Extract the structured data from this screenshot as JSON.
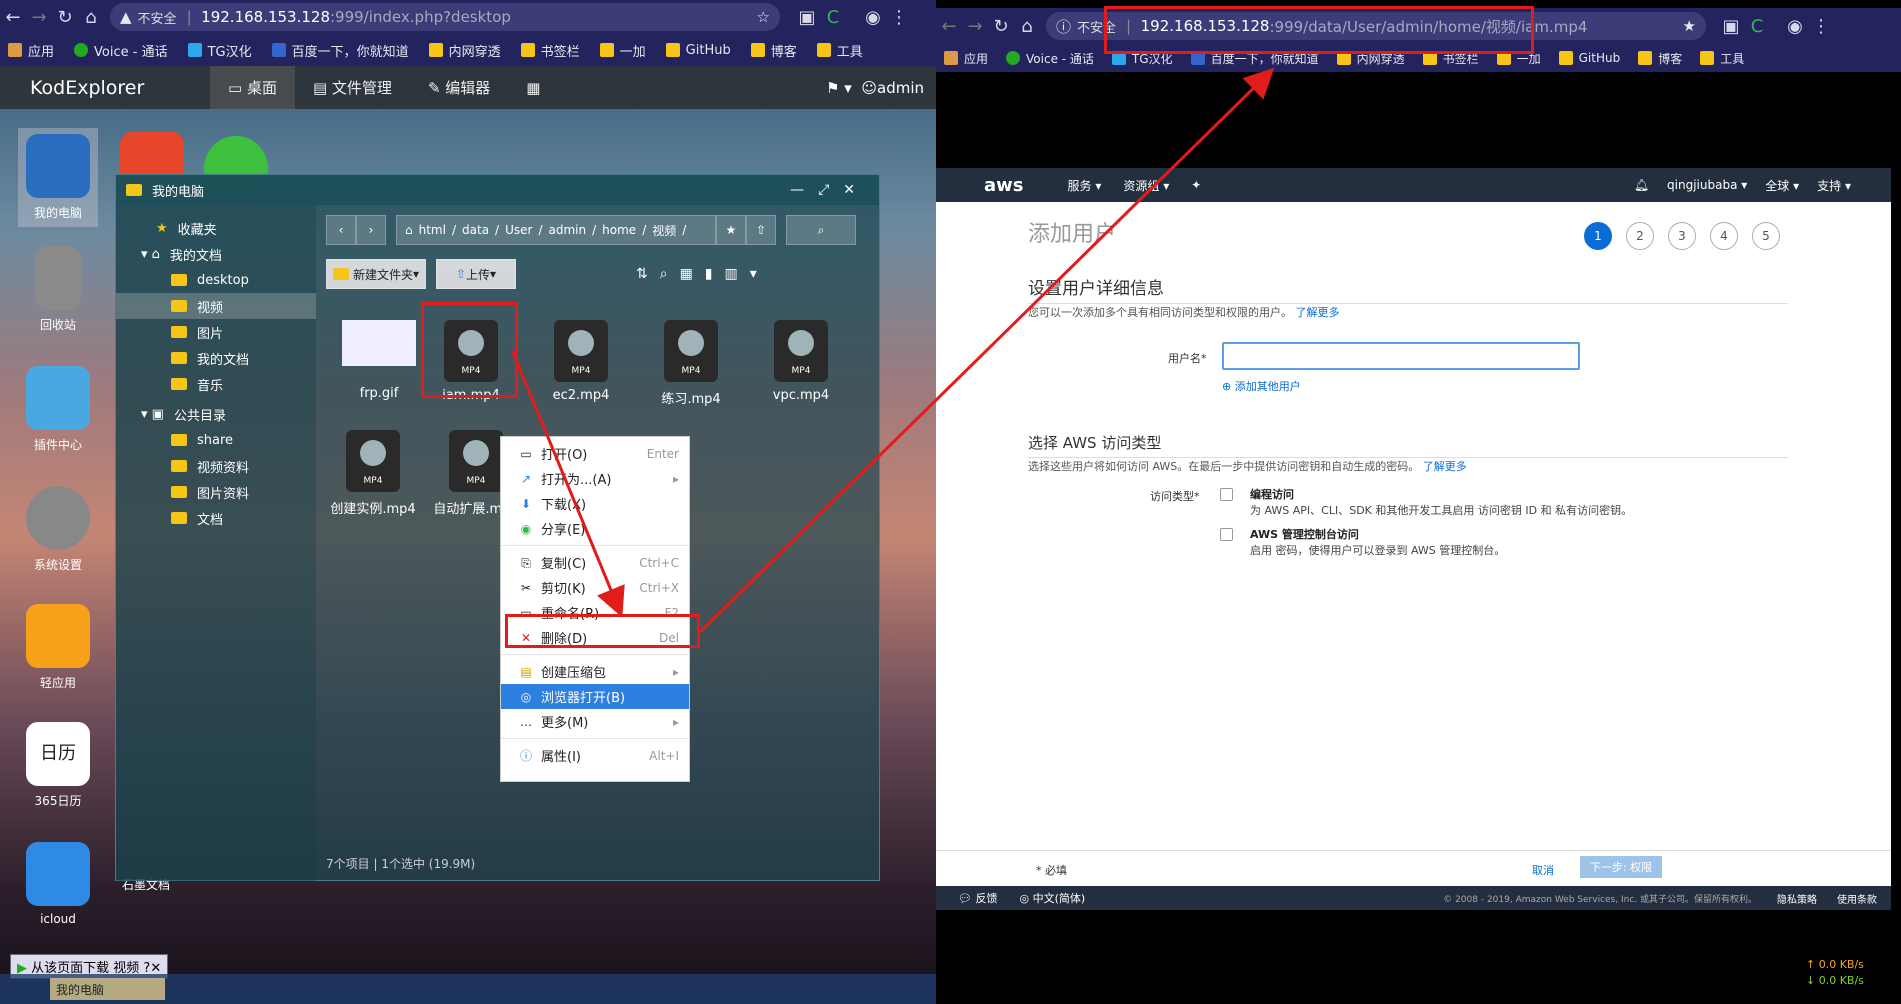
{
  "left_browser": {
    "insecure": "不安全",
    "url_host": "192.168.153.128",
    "url_path": ":999/index.php?desktop",
    "bookmarks": [
      "应用",
      "Voice - 通话",
      "TG汉化",
      "百度一下，你就知道",
      "内网穿透",
      "书签栏",
      "一加",
      "GitHub",
      "博客",
      "工具"
    ]
  },
  "kod": {
    "logo": "KodExplorer",
    "tabs": [
      "桌面",
      "文件管理",
      "编辑器"
    ],
    "user": "admin"
  },
  "desktop_icons": [
    "我的电脑",
    "回收站",
    "插件中心",
    "系统设置",
    "轻应用",
    "365日历",
    "icloud",
    "石墨文档"
  ],
  "explorer": {
    "title": "我的电脑",
    "tree": [
      "收藏夹",
      "我的文档",
      "desktop",
      "视频",
      "图片",
      "我的文档",
      "音乐",
      "公共目录",
      "share",
      "视频资料",
      "图片资料",
      "文档"
    ],
    "breadcrumb": [
      "html",
      "data",
      "User",
      "admin",
      "home",
      "视频"
    ],
    "new_folder": "新建文件夹",
    "upload": "上传",
    "files": [
      "frp.gif",
      "iam.mp4",
      "ec2.mp4",
      "练习.mp4",
      "vpc.mp4",
      "创建实例.mp4",
      "自动扩展.mp4"
    ],
    "status": "7个项目",
    "selected": "1个选中 (19.9M)"
  },
  "context_menu": [
    {
      "label": "打开(O)",
      "key": "Enter"
    },
    {
      "label": "打开为...(A)",
      "key": "▸"
    },
    {
      "label": "下载(X)",
      "key": ""
    },
    {
      "label": "分享(E)",
      "key": ""
    },
    {
      "label": "复制(C)",
      "key": "Ctrl+C"
    },
    {
      "label": "剪切(K)",
      "key": "Ctrl+X"
    },
    {
      "label": "重命名(R)",
      "key": "F2"
    },
    {
      "label": "删除(D)",
      "key": "Del"
    },
    {
      "label": "创建压缩包",
      "key": "▸"
    },
    {
      "label": "浏览器打开(B)",
      "key": ""
    },
    {
      "label": "更多(M)",
      "key": "▸"
    },
    {
      "label": "属性(I)",
      "key": "Alt+I"
    }
  ],
  "taskbar": {
    "download_bar": "从该页面下载 视频",
    "task": "我的电脑"
  },
  "right_browser": {
    "insecure": "不安全",
    "url_host": "192.168.153.128",
    "url_path": ":999/data/User/admin/home/视频/iam.mp4",
    "bookmarks": [
      "应用",
      "Voice - 通话",
      "TG汉化",
      "百度一下，你就知道",
      "内网穿透",
      "书签栏",
      "一加",
      "GitHub",
      "博客",
      "工具"
    ]
  },
  "aws": {
    "logo": "aws",
    "services": "服务",
    "resource_groups": "资源组",
    "account": "qingjiubaba",
    "region": "全球",
    "support": "支持",
    "page_title": "添加用户",
    "steps": [
      "1",
      "2",
      "3",
      "4",
      "5"
    ],
    "section1": "设置用户详细信息",
    "section1_desc": "您可以一次添加多个具有相同访问类型和权限的用户。",
    "learn_more": "了解更多",
    "username_label": "用户名*",
    "add_user": "添加其他用户",
    "section2": "选择 AWS 访问类型",
    "section2_desc": "选择这些用户将如何访问 AWS。在最后一步中提供访问密钥和自动生成的密码。",
    "access_type_label": "访问类型*",
    "opt1_title": "编程访问",
    "opt1_desc": "为 AWS API、CLI、SDK 和其他开发工具启用 访问密钥 ID 和 私有访问密钥。",
    "opt2_title": "AWS 管理控制台访问",
    "opt2_desc": "启用 密码，使得用户可以登录到 AWS 管理控制台。",
    "required": "* 必填",
    "cancel": "取消",
    "next": "下一步: 权限",
    "feedback": "反馈",
    "language": "中文(简体)",
    "copyright": "© 2008 - 2019, Amazon Web Services, Inc. 或其子公司。保留所有权利。",
    "privacy": "隐私策略",
    "terms": "使用条款"
  },
  "net_speed": {
    "up": "↑ 0.0 KB/s",
    "down": "↓ 0.0 KB/s"
  }
}
